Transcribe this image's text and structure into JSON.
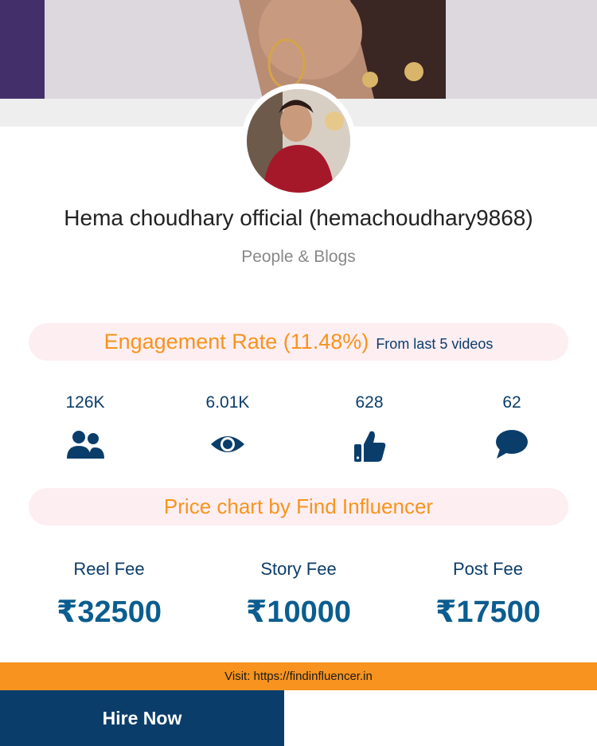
{
  "profile": {
    "name": "Hema choudhary official (hemachoudhary9868)",
    "category": "People & Blogs"
  },
  "engagement": {
    "title": "Engagement Rate (11.48%)",
    "subtitle": "From last 5 videos"
  },
  "stats": [
    {
      "value": "126K",
      "icon": "followers-icon"
    },
    {
      "value": "6.01K",
      "icon": "eye-icon"
    },
    {
      "value": "628",
      "icon": "thumbs-up-icon"
    },
    {
      "value": "62",
      "icon": "comment-icon"
    }
  ],
  "price_chart": {
    "title": "Price chart by Find Influencer",
    "fees": [
      {
        "label": "Reel Fee",
        "value": "₹32500"
      },
      {
        "label": "Story Fee",
        "value": "₹10000"
      },
      {
        "label": "Post Fee",
        "value": "₹17500"
      }
    ]
  },
  "footer": {
    "visit_text": "Visit: https://findinfluencer.in"
  },
  "hire_button": {
    "label": "Hire Now"
  },
  "colors": {
    "accent_orange": "#f7941d",
    "navy": "#0b3d6b",
    "pill_bg": "#fdeef2"
  }
}
